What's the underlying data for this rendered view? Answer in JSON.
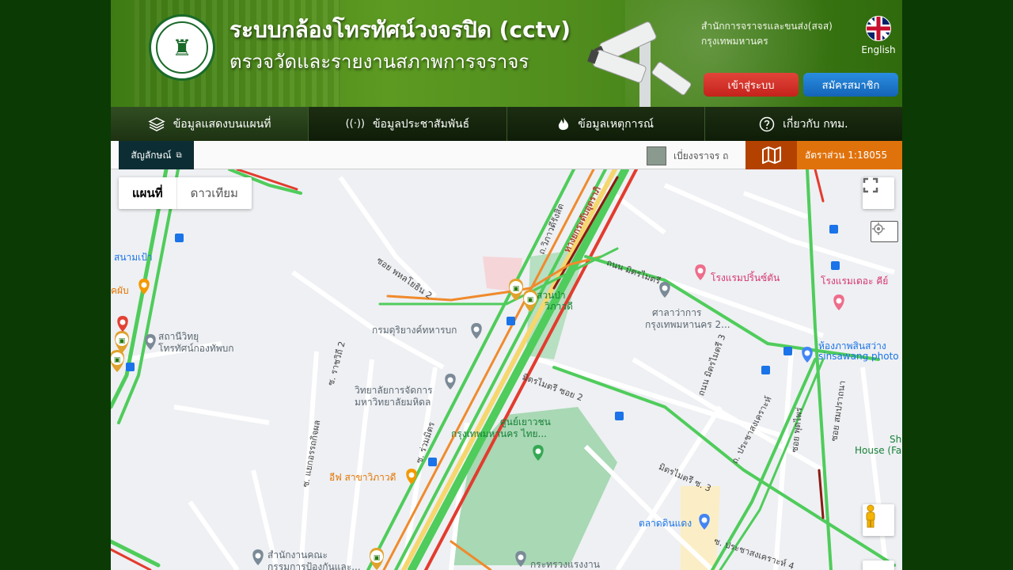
{
  "header": {
    "title": "ระบบกล้องโทรทัศน์วงจรปิด (cctv)",
    "subtitle": "ตรวจวัดและรายงานสภาพการจราจร",
    "org_line1": "สำนักการจราจรและขนส่ง(สจส)",
    "org_line2": "กรุงเทพมหานคร",
    "language_label": "English",
    "login_label": "เข้าสู่ระบบ",
    "register_label": "สมัครสมาชิก"
  },
  "nav": {
    "items": [
      {
        "label": "ข้อมูลแสดงบนแผนที่",
        "icon": "layers-icon"
      },
      {
        "label": "ข้อมูลประชาสัมพันธ์",
        "icon": "broadcast-icon"
      },
      {
        "label": "ข้อมูลเหตุการณ์",
        "icon": "fire-icon"
      },
      {
        "label": "เกี่ยวกับ กทม.",
        "icon": "help-circle-icon"
      }
    ]
  },
  "toolbar": {
    "legend_label": "สัญลักษณ์",
    "ticker_text": "เบี่ยงจราจร ถ",
    "scale_label": "อัตราส่วน 1:18055"
  },
  "map": {
    "type_map": "แผนที่",
    "type_satellite": "ดาวเทียม",
    "places": {
      "p1": "สนามเป้า",
      "p2": "สถานีวิทยุ",
      "p2b": "โทรทัศน์กองทัพบก",
      "p3": "กรมดุริยางค์ทหารบก",
      "p4": "วิทยาลัยการจัดการ",
      "p4b": "มหาวิทยาลัยมหิดล",
      "p5": "ศูนย์เยาวชน",
      "p5b": "กรุงเทพมหานคร ไทย...",
      "p6": "อีฟ สาขาวิภาวดี",
      "p7": "สำนักงานคณะ",
      "p7b": "กรรมการป้องกันและ...",
      "p8": "กระทรวงแรงงาน",
      "p9": "ตลาดดินแดง",
      "p10": "ศาลาว่าการ",
      "p10b": "กรุงเทพมหานคร 2...",
      "p11": "โรงแรมปริ้นซ์ตัน",
      "p12": "โรงแรมเดอะ คีย์",
      "p13": "ห้องภาพสินสว่าง",
      "p13b": "sinsawang photo",
      "p14": "สวนป่า",
      "p14b": "วิภาวดี",
      "p15": "Sh",
      "p15b": "House (Fa",
      "p16": "คผับ"
    },
    "roads": {
      "r1": "ซอย พหลโยธิน 2",
      "r2": "ถ.วิภาวดีรังสิต",
      "r3": "ทางยกระดับอุตราภิ",
      "r4": "ถนน มิตรไมตรี",
      "r5": "มิตรไมตรี ซอย 2",
      "r6": "มิตรไมตรี ซ. 3",
      "r7": "ถ. ประชาสงเคราะห์",
      "r8": "ซ. ราชวิถี 2",
      "r9": "ซ. แยกอรรถกิจผล",
      "r10": "ซ. ร่วมมิตร",
      "r11": "ถนน มิตรไมตรี 3",
      "r12": "ซ. ประชาสงเคราะห์ 4",
      "r13": "ซอย สมปราถนา",
      "r14": "ซอย พุดไพร่"
    }
  },
  "colors": {
    "header_green": "#4f8c1d",
    "nav_dark": "#1c2e12",
    "login_red": "#d0302a",
    "register_blue": "#1f7ad0",
    "scale_orange": "#e0720c",
    "legend_teal": "#0c2d34",
    "traffic_green": "#4fcc5b",
    "traffic_orange": "#f08a2c",
    "traffic_red": "#e33b2e"
  }
}
